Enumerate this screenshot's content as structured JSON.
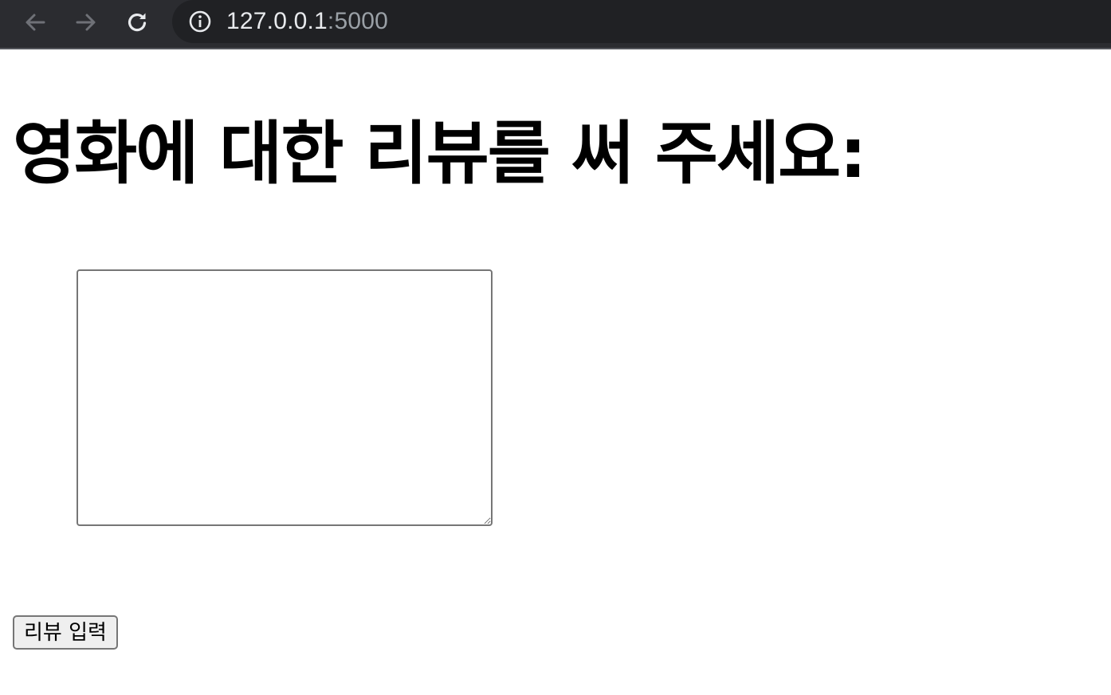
{
  "browser": {
    "url_host": "127.0.0.1",
    "url_port": ":5000",
    "icons": {
      "back": "arrow-left-icon",
      "forward": "arrow-right-icon",
      "reload": "reload-icon",
      "site_info": "info-icon"
    }
  },
  "page": {
    "heading": "영화에 대한 리뷰를 써 주세요:",
    "review_textarea": {
      "value": "",
      "placeholder": ""
    },
    "submit_label": "리뷰 입력"
  }
}
